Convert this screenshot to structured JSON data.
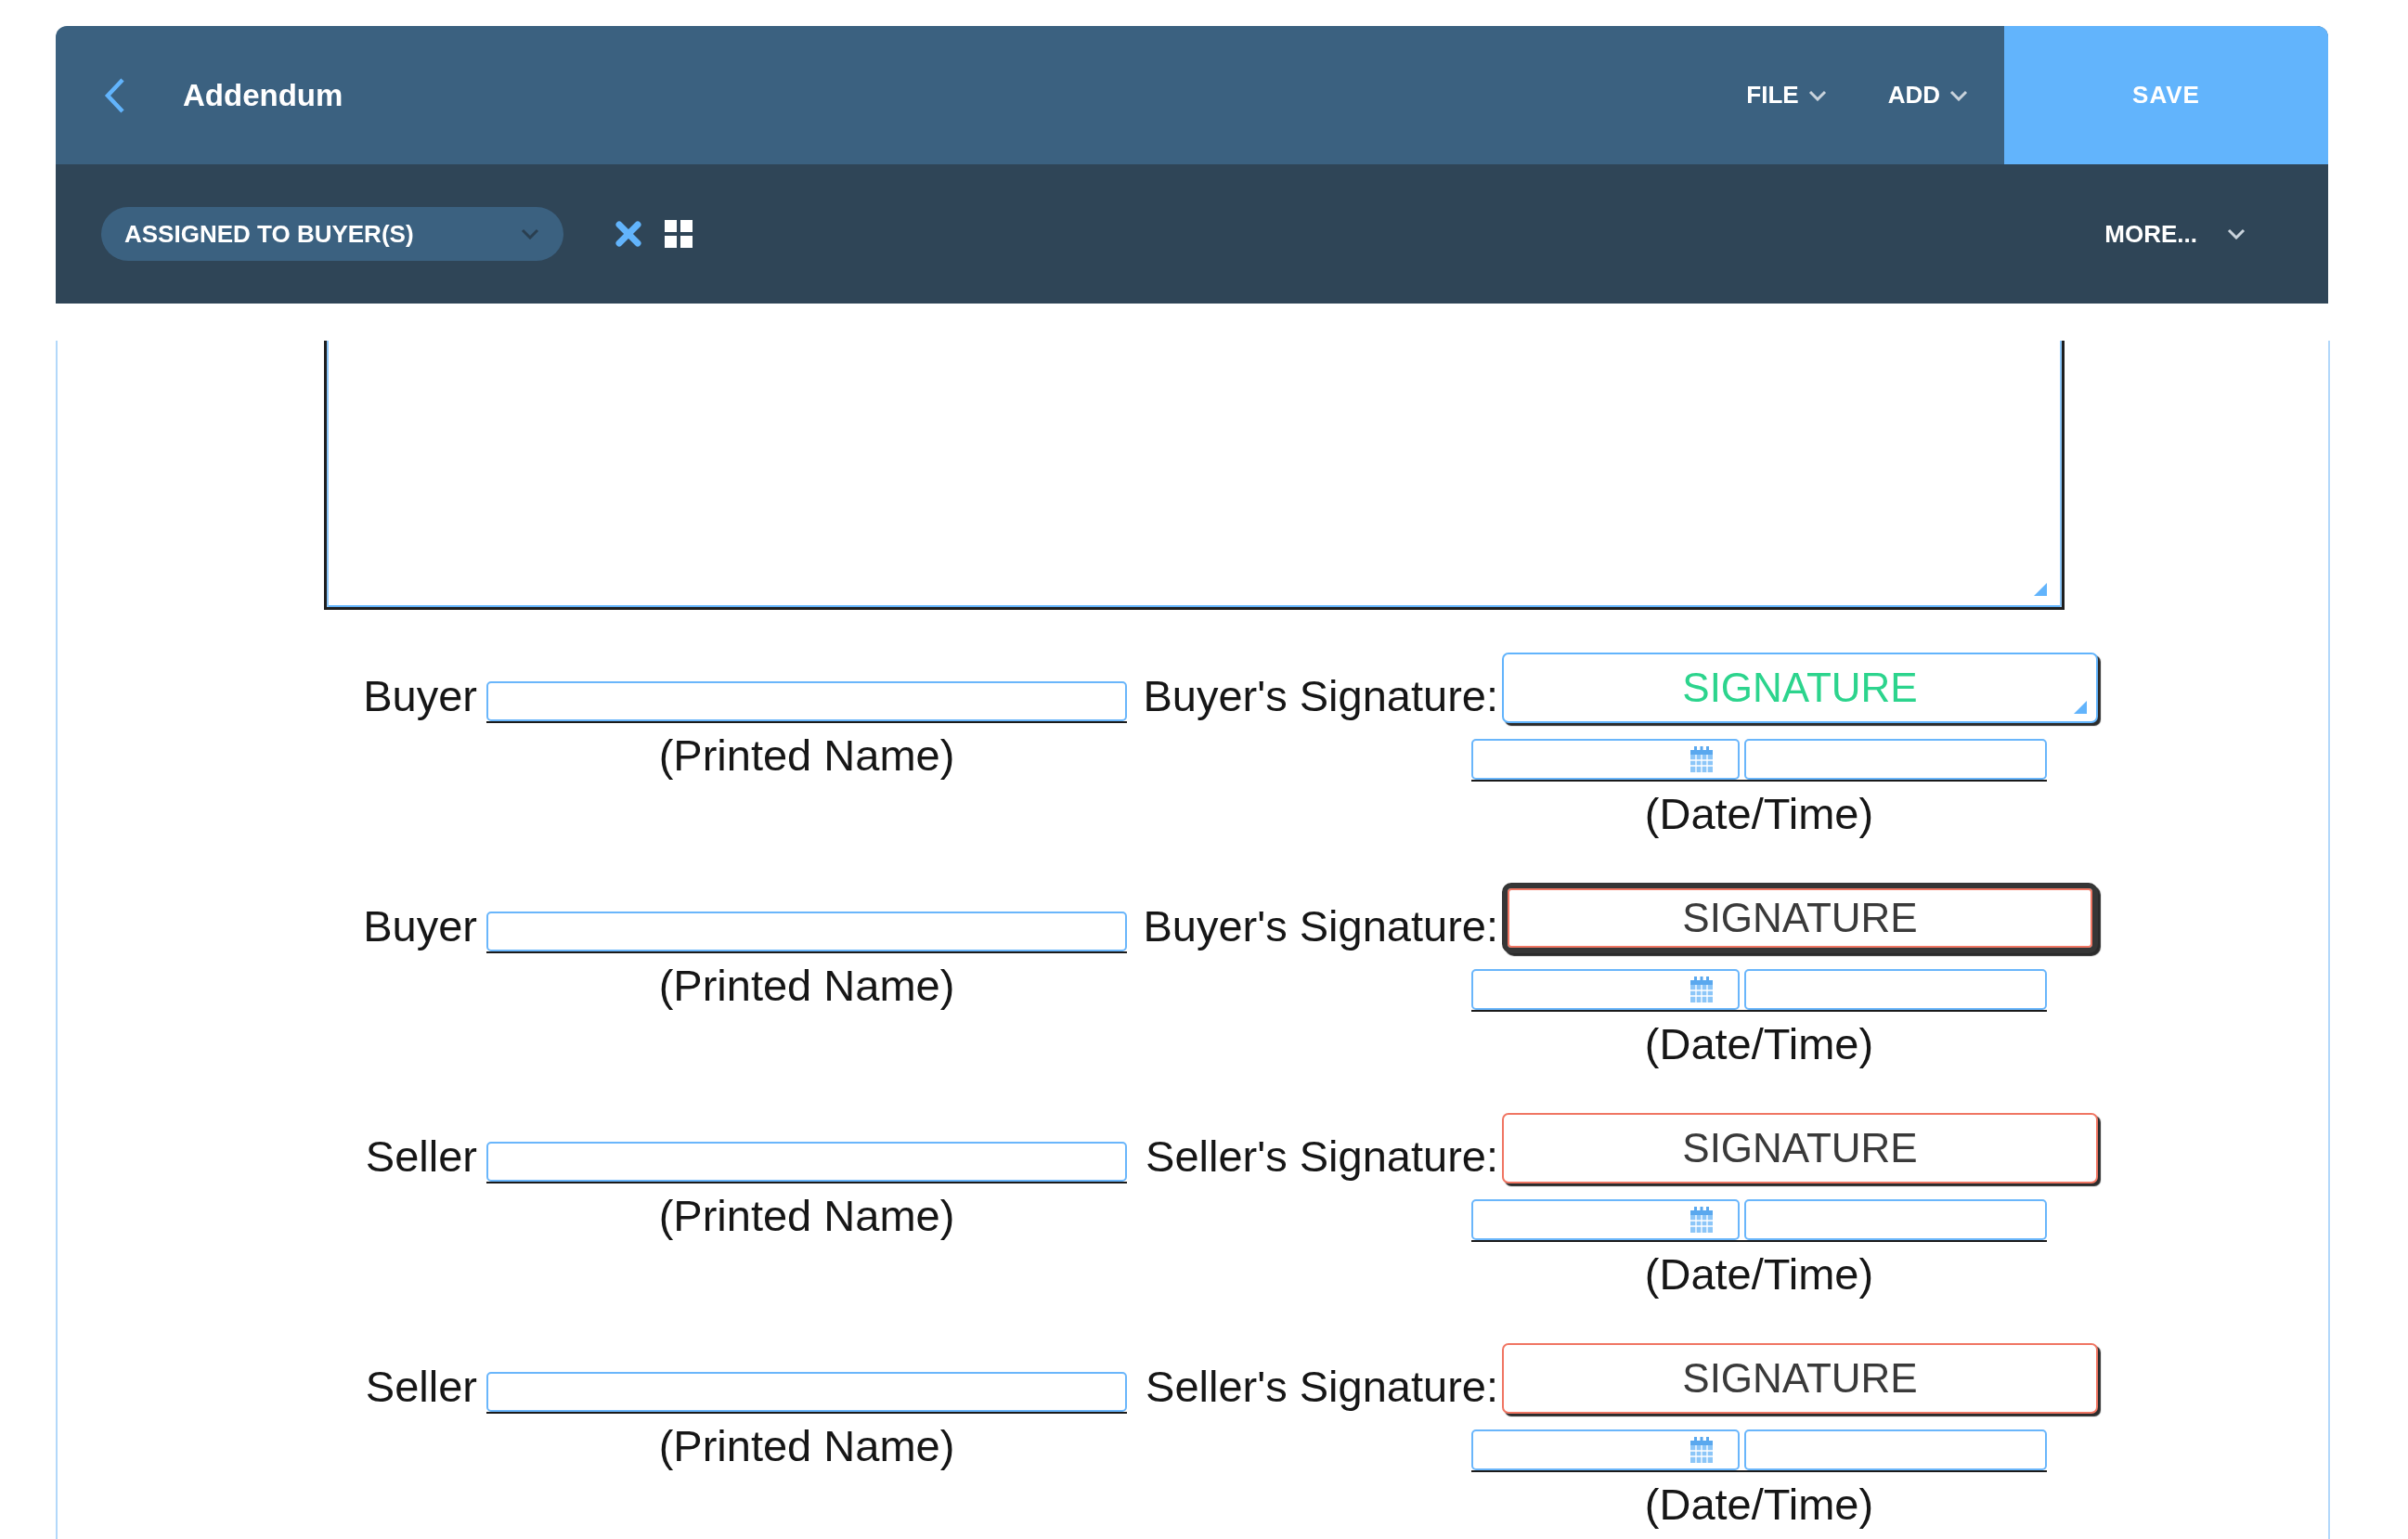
{
  "header": {
    "title": "Addendum",
    "menus": [
      "FILE",
      "ADD"
    ],
    "save_button": "SAVE"
  },
  "toolbar": {
    "assignment_dropdown": "ASSIGNED TO BUYER(S)",
    "more_menu": "MORE..."
  },
  "signature_blocks": [
    {
      "party": "Buyer",
      "name_caption": "(Printed Name)",
      "signature_label": "Buyer's Signature:",
      "signature_button": "SIGNATURE",
      "active": true,
      "selected": false,
      "date_caption": "(Date/Time)"
    },
    {
      "party": "Buyer",
      "name_caption": "(Printed Name)",
      "signature_label": "Buyer's Signature:",
      "signature_button": "SIGNATURE",
      "active": false,
      "selected": true,
      "date_caption": "(Date/Time)"
    },
    {
      "party": "Seller",
      "name_caption": "(Printed Name)",
      "signature_label": "Seller's Signature:",
      "signature_button": "SIGNATURE",
      "active": false,
      "selected": false,
      "date_caption": "(Date/Time)"
    },
    {
      "party": "Seller",
      "name_caption": "(Printed Name)",
      "signature_label": "Seller's Signature:",
      "signature_button": "SIGNATURE",
      "active": false,
      "selected": false,
      "date_caption": "(Date/Time)"
    }
  ]
}
